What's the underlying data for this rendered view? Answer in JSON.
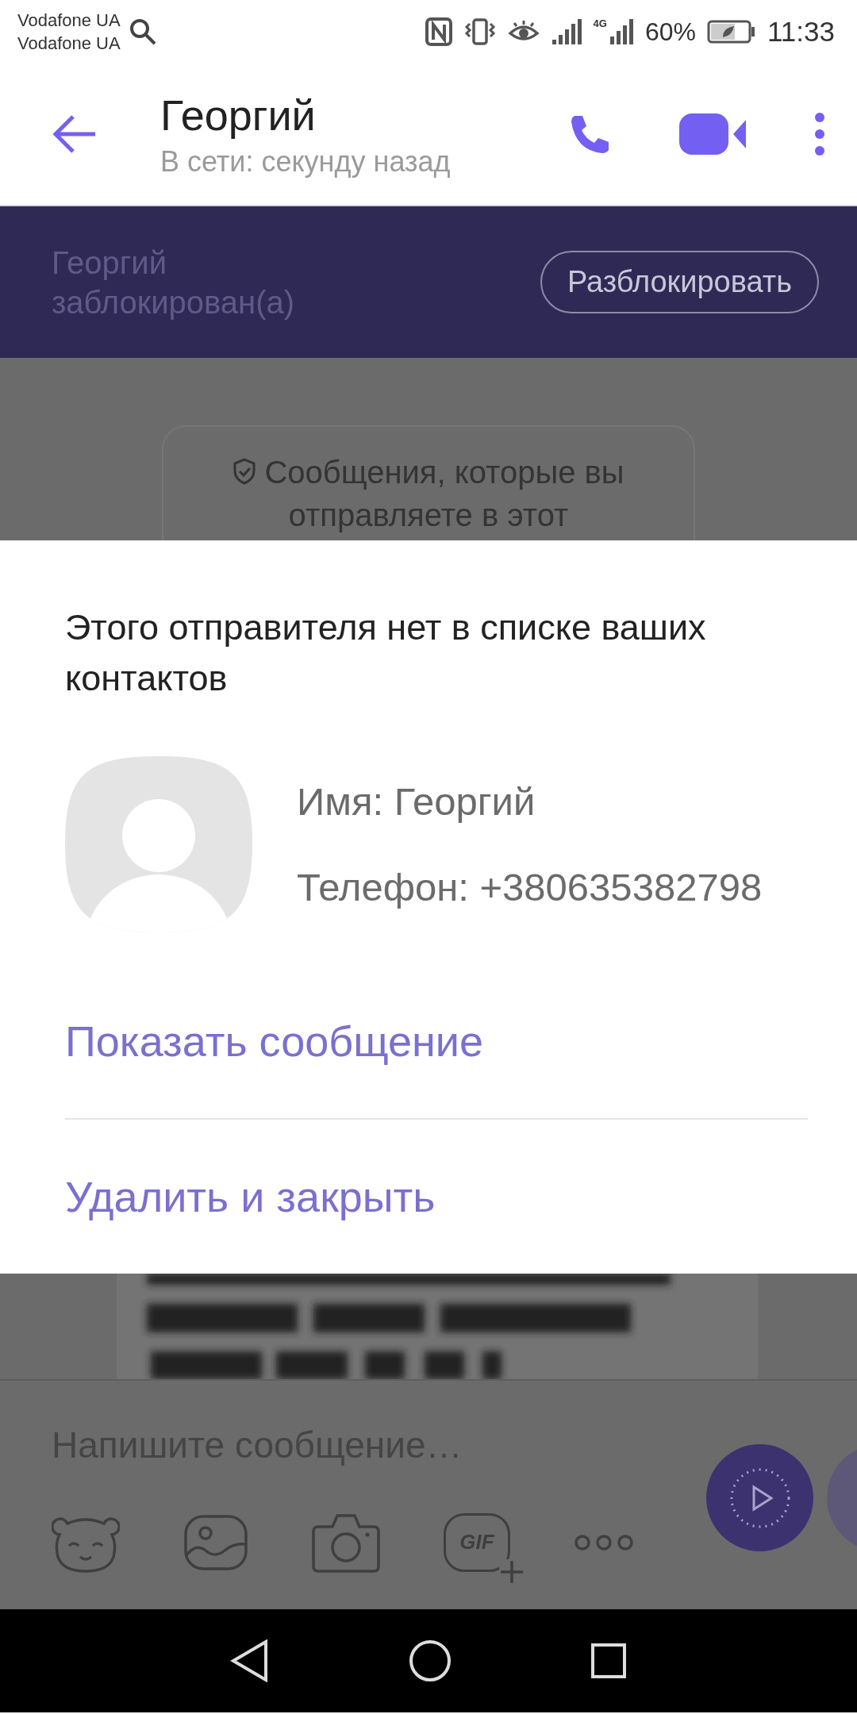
{
  "status_bar": {
    "carriers": [
      "Vodafone UA",
      "Vodafone UA"
    ],
    "network_label": "4G",
    "battery": "60%",
    "time": "11:33"
  },
  "header": {
    "title": "Георгий",
    "subtitle": "В сети: секунду назад"
  },
  "blocked_banner": {
    "text": "Георгий заблокирован(а)",
    "button": "Разблокировать"
  },
  "notice": {
    "text": "Сообщения, которые вы отправляете в этот"
  },
  "sheet": {
    "title": "Этого отправителя нет в списке ваших контактов",
    "name": "Имя: Георгий",
    "phone": "Телефон: +380635382798",
    "actions": [
      {
        "label": "Показать сообщение"
      },
      {
        "label": "Удалить и закрыть"
      }
    ]
  },
  "composer": {
    "placeholder": "Напишите сообщение…",
    "tools": [
      {
        "kind": "sticker"
      },
      {
        "kind": "gallery"
      },
      {
        "kind": "camera"
      },
      {
        "kind": "gif",
        "label": "GIF"
      },
      {
        "kind": "more"
      }
    ]
  }
}
